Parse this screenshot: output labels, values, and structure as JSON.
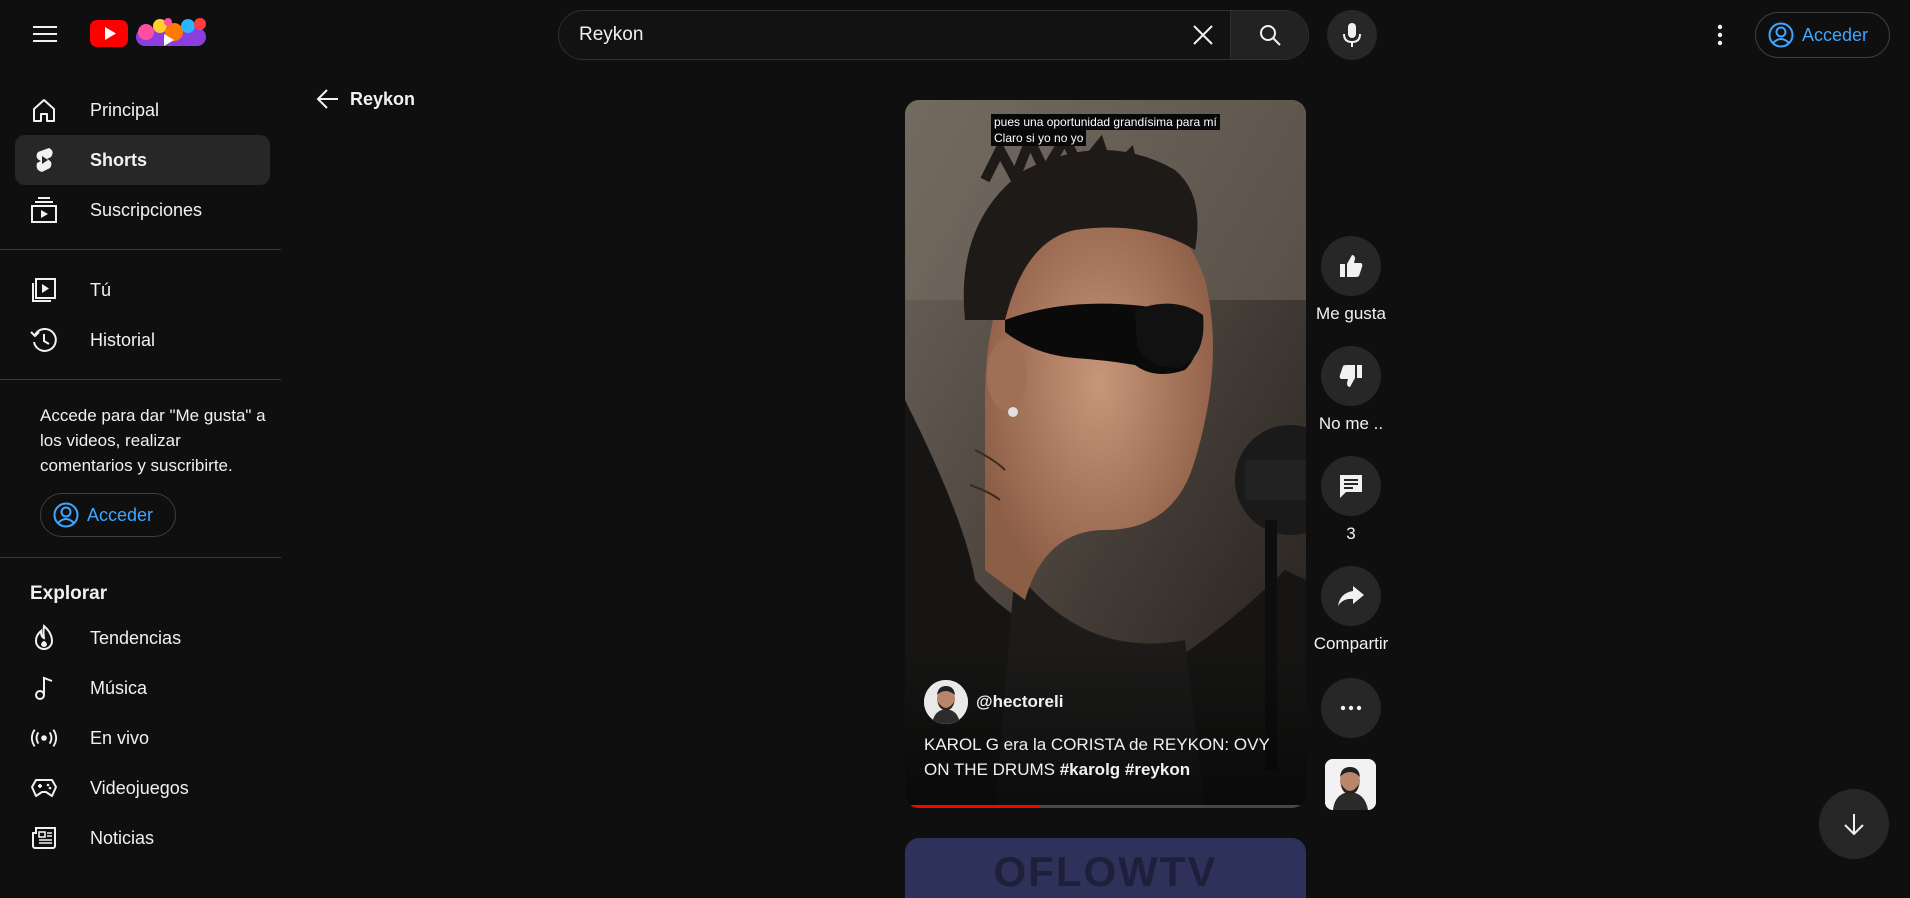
{
  "masthead": {
    "search": {
      "value": "Reykon"
    },
    "signin_label": "Acceder"
  },
  "sidebar": {
    "primary": [
      {
        "label": "Principal",
        "icon": "home-icon"
      },
      {
        "label": "Shorts",
        "icon": "shorts-icon",
        "active": true
      },
      {
        "label": "Suscripciones",
        "icon": "subscriptions-icon"
      }
    ],
    "you": [
      {
        "label": "Tú",
        "icon": "you-icon"
      },
      {
        "label": "Historial",
        "icon": "history-icon"
      }
    ],
    "signin_prompt": "Accede para dar \"Me gusta\" a los videos, realizar comentarios y suscribirte.",
    "signin_label": "Acceder",
    "explore_title": "Explorar",
    "explore": [
      {
        "label": "Tendencias",
        "icon": "trending-icon"
      },
      {
        "label": "Música",
        "icon": "music-icon"
      },
      {
        "label": "En vivo",
        "icon": "live-icon"
      },
      {
        "label": "Videojuegos",
        "icon": "gaming-icon"
      },
      {
        "label": "Noticias",
        "icon": "news-icon"
      }
    ]
  },
  "back": {
    "label": "Reykon"
  },
  "short": {
    "captions": [
      "pues una oportunidad grandísima para mí",
      "Claro si yo no yo"
    ],
    "channel": "@hectoreli",
    "title_text": "KAROL G era la CORISTA de REYKON: OVY ON THE DRUMS ",
    "hashtags": "#karolg #reykon",
    "progress": 0.33
  },
  "actions": {
    "like": "Me gusta",
    "dislike": "No me ..",
    "comments": "3",
    "share": "Compartir"
  },
  "next_short": {
    "text": "OFLOWTV"
  },
  "colors": {
    "accent_blue": "#3ea6ff",
    "brand_red": "#ff0000",
    "background": "#0f0f0f"
  }
}
